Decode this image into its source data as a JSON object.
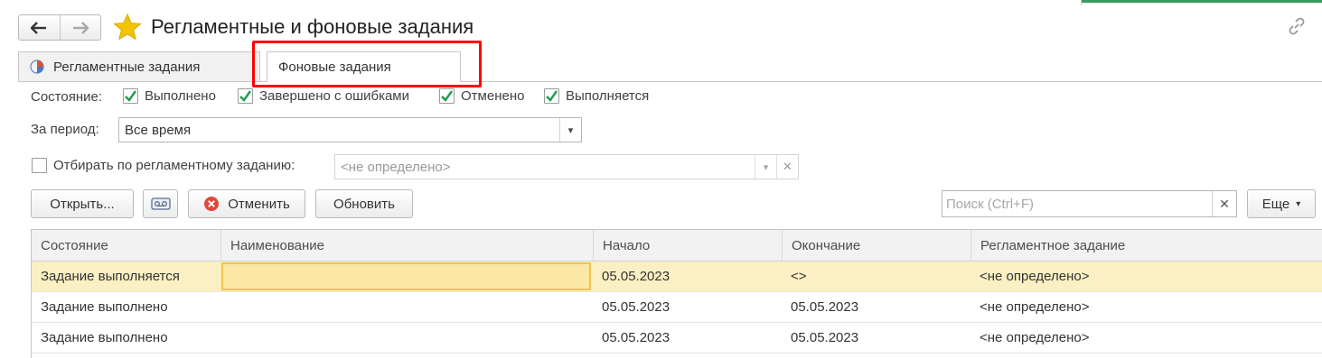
{
  "header": {
    "title": "Регламентные и фоновые задания",
    "back_glyph": "🡐",
    "forward_glyph": "🡒",
    "icons": [
      "arrow-left-icon",
      "arrow-right-icon",
      "star-icon",
      "link-icon"
    ]
  },
  "tabs": [
    {
      "label": "Регламентные задания",
      "icon": "clock-icon",
      "active": false
    },
    {
      "label": "Фоновые задания",
      "active": true
    }
  ],
  "filters": {
    "state_label": "Состояние:",
    "state_options": [
      {
        "label": "Выполнено",
        "checked": true
      },
      {
        "label": "Завершено с ошибками",
        "checked": true
      },
      {
        "label": "Отменено",
        "checked": true
      },
      {
        "label": "Выполняется",
        "checked": true
      }
    ],
    "period_label": "За период:",
    "period_value": "Все время",
    "scheduled_filter_label": "Отбирать по регламентному заданию:",
    "scheduled_filter_checked": false,
    "scheduled_filter_value": "<не определено>",
    "clear_glyph": "✕",
    "dropdown_glyph": "▾"
  },
  "toolbar": {
    "open_label": "Открыть...",
    "cancel_label": "Отменить",
    "refresh_label": "Обновить",
    "more_label": "Еще",
    "more_glyph": "▾",
    "search_placeholder": "Поиск (Ctrl+F)",
    "search_value": "",
    "search_clear_glyph": "✕"
  },
  "table": {
    "columns": [
      "Состояние",
      "Наименование",
      "Начало",
      "Окончание",
      "Регламентное задание"
    ],
    "rows": [
      {
        "state": "Задание выполняется",
        "name": "",
        "start": "05.05.2023",
        "end": "<>",
        "scheduled": "<не определено>",
        "selected": true
      },
      {
        "state": "Задание выполнено",
        "name": "",
        "start": "05.05.2023",
        "end": "05.05.2023",
        "scheduled": "<не определено>",
        "selected": false
      },
      {
        "state": "Задание выполнено",
        "name": "",
        "start": "05.05.2023",
        "end": "05.05.2023",
        "scheduled": "<не определено>",
        "selected": false
      }
    ]
  },
  "colors": {
    "accent_star": "#f5c400",
    "highlight_border": "#ff0000",
    "selected_row": "#fbf0c3",
    "check_green": "#1e9c4a",
    "cancel_red": "#e0483a"
  }
}
